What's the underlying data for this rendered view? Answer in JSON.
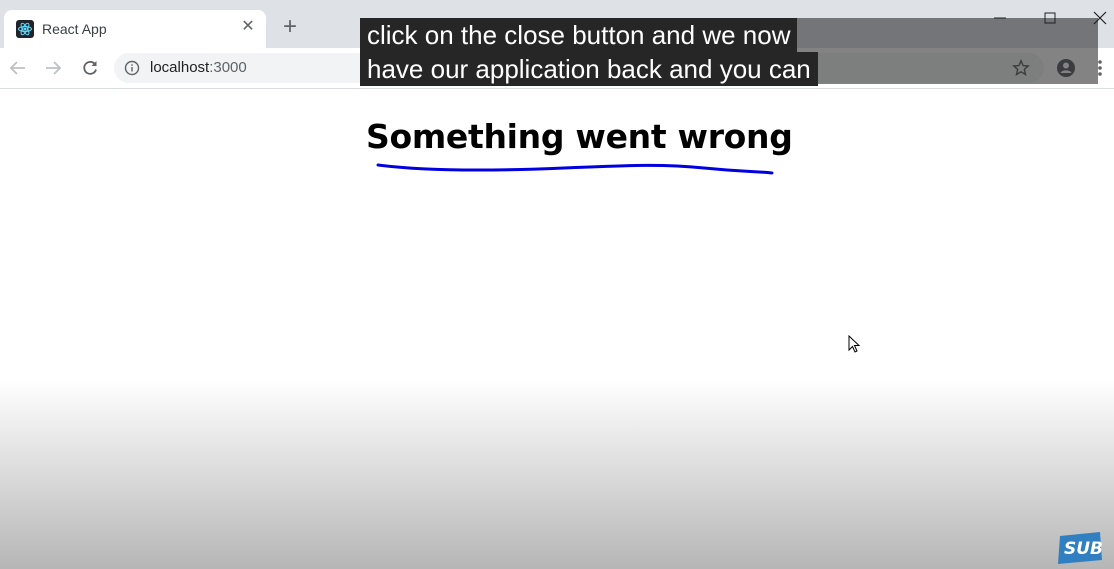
{
  "browser": {
    "tab": {
      "title": "React App",
      "close_glyph": "✕",
      "favicon": "react-logo-icon"
    },
    "new_tab_glyph": "+",
    "url_host": "localhost",
    "url_port": ":3000",
    "accent_color": "#1a73e8"
  },
  "page": {
    "heading": "Something went wrong",
    "annotation_color": "#0000e0"
  },
  "caption": {
    "line1": "click on the close button and we now",
    "line2": "have our application back and you can"
  },
  "watermark": {
    "text": "SUB",
    "color": "#2f7fc1"
  }
}
